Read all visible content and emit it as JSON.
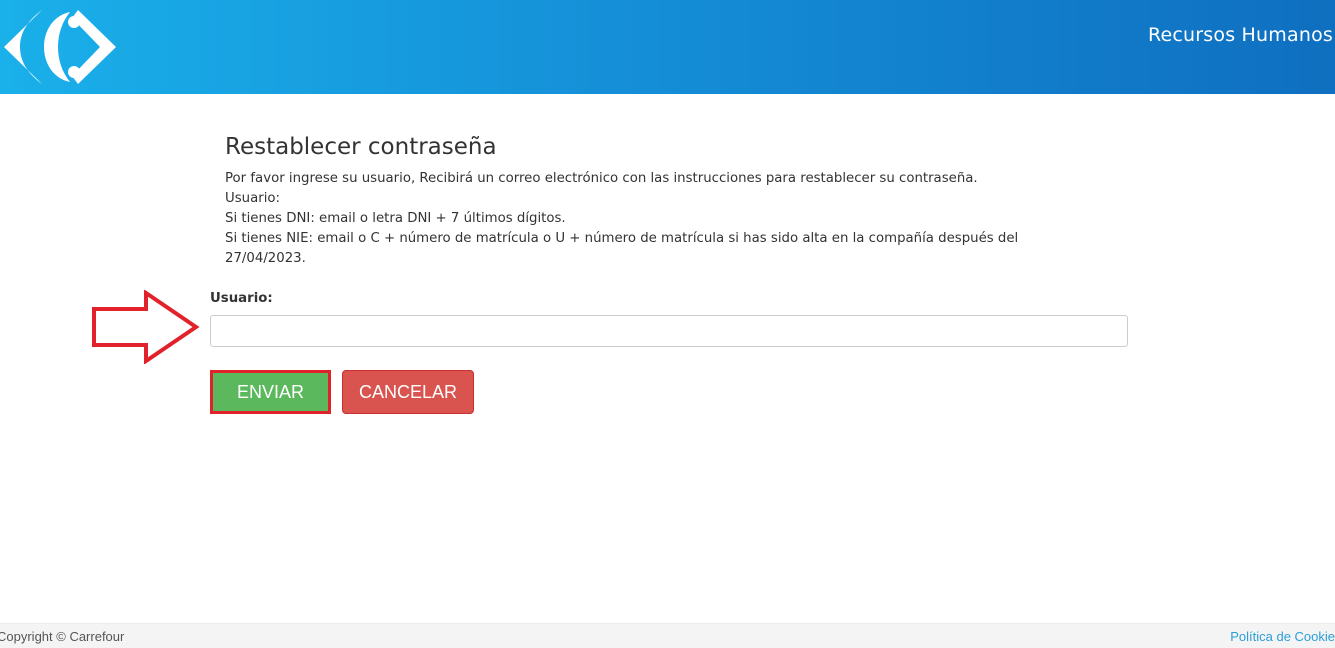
{
  "header": {
    "title": "Recursos Humanos",
    "logo_icon": "carrefour-logo-icon",
    "gradient_start": "#1ab0ea",
    "gradient_end": "#0f6fc0"
  },
  "main": {
    "title": "Restablecer contraseña",
    "instructions": [
      "Por favor ingrese su usuario, Recibirá un correo electrónico con las instrucciones para restablecer su contraseña.",
      "Usuario:",
      "Si tienes DNI: email o letra DNI + 7 últimos dígitos.",
      "Si tienes NIE: email o C + número de matrícula o U + número de matrícula si has sido alta en la compañía después del",
      "27/04/2023."
    ],
    "form": {
      "user_label": "Usuario:",
      "user_value": "",
      "user_placeholder": ""
    },
    "buttons": {
      "send_label": "ENVIAR",
      "cancel_label": "CANCELAR",
      "send_color": "#5cb85c",
      "cancel_color": "#d9534f"
    },
    "annotation": {
      "arrow_icon": "right-arrow-outline-icon",
      "highlight_color": "#e2222a"
    }
  },
  "footer": {
    "copyright": "Copyright © Carrefour",
    "cookie_link": "Política de Cookie"
  }
}
